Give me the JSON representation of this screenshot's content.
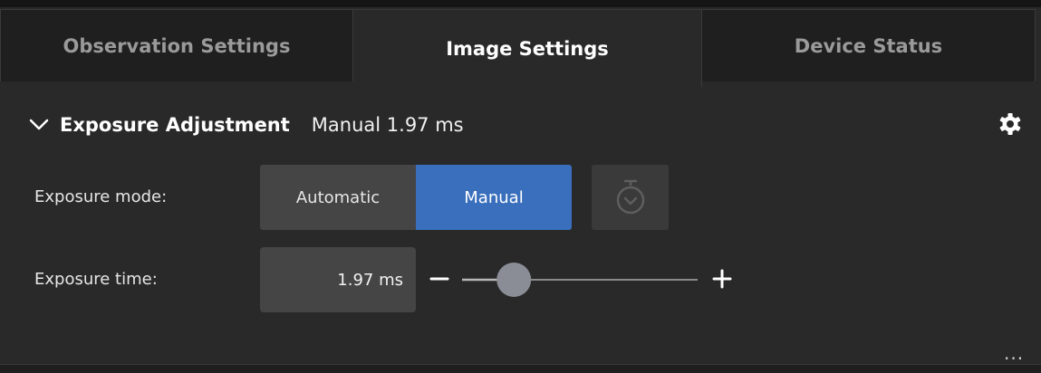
{
  "tabs": [
    {
      "label": "Observation Settings",
      "active": false
    },
    {
      "label": "Image Settings",
      "active": true
    },
    {
      "label": "Device Status",
      "active": false
    }
  ],
  "section": {
    "title": "Exposure Adjustment",
    "summary": "Manual 1.97 ms",
    "expanded": true
  },
  "exposure_mode": {
    "label": "Exposure mode:",
    "options": [
      "Automatic",
      "Manual"
    ],
    "selected": "Manual"
  },
  "exposure_time": {
    "label": "Exposure time:",
    "value": "1.97 ms",
    "slider_fraction": 0.22
  },
  "more_label": "...",
  "colors": {
    "background": "#292929",
    "accent": "#3a6fbd",
    "control": "#454545"
  },
  "icons": {
    "collapse": "chevron-down-icon",
    "settings": "gear-icon",
    "timer": "stopwatch-icon",
    "decrease": "minus-icon",
    "increase": "plus-icon"
  }
}
